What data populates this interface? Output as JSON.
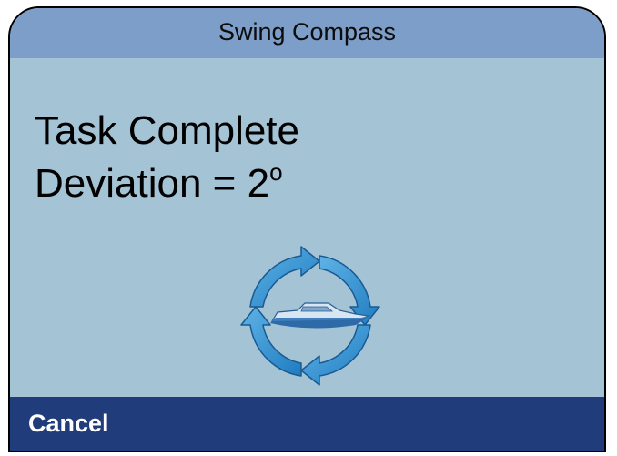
{
  "window": {
    "title": "Swing Compass"
  },
  "message": {
    "line1": "Task Complete",
    "line2_prefix": "Deviation = 2",
    "line2_degree": "o"
  },
  "graphic": {
    "icon": "boat-rotation-icon",
    "arrow_color": "#2f93d3",
    "boat_color": "#3f7fbf"
  },
  "softkeys": {
    "cancel_label": "Cancel"
  },
  "colors": {
    "title_bar": "#7c9ec8",
    "body": "#a4c3d5",
    "softkey_bar": "#203c7a"
  }
}
